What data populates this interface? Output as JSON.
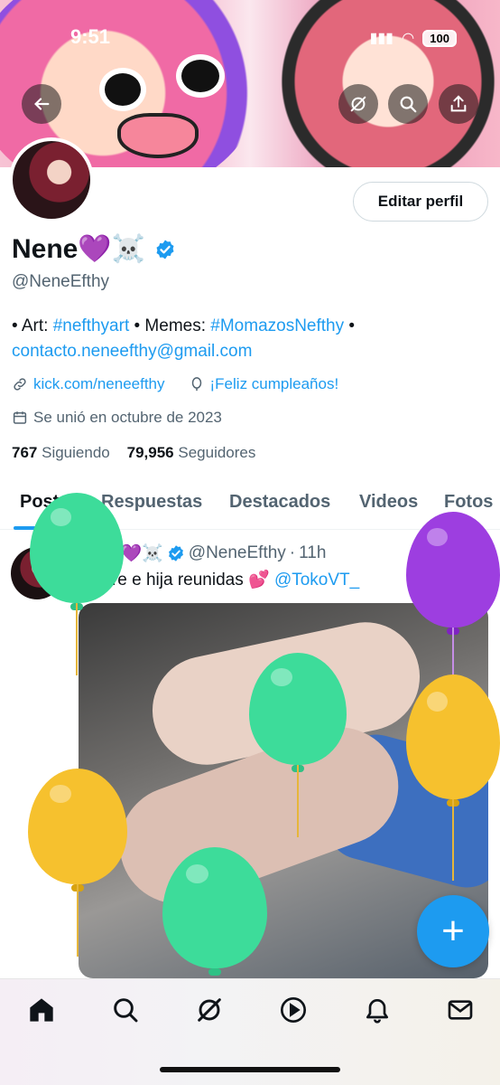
{
  "status_bar": {
    "time": "9:51",
    "battery": "100"
  },
  "profile": {
    "edit_button": "Editar perfil",
    "name": "Nene💜☠️",
    "handle": "@NeneEfthy",
    "bio": {
      "part1": "• Art: ",
      "tag1": "#nefthyart",
      "part2": " • Memes: ",
      "tag2": "#MomazosNefthy",
      "part3": " •",
      "email": "contacto.neneefthy@gmail.com"
    },
    "website": "kick.com/neneefthy",
    "birthday": "¡Feliz cumpleaños!",
    "joined": "Se unió en octubre de 2023",
    "following_count": "767",
    "following_label": "Siguiendo",
    "followers_count": "79,956",
    "followers_label": "Seguidores"
  },
  "tabs": [
    "Posts",
    "Respuestas",
    "Destacados",
    "Videos",
    "Fotos"
  ],
  "post": {
    "author": "Nene💜☠️",
    "handle": "@NeneEfthy",
    "time": "11h",
    "text": "Madre e hija reunidas 💕 ",
    "mention": "@TokoVT_",
    "more": "···"
  },
  "fab_symbol": "+",
  "bottom_nav": [
    "home-icon",
    "search-icon",
    "grok-icon",
    "video-icon",
    "notifications-icon",
    "messages-icon"
  ],
  "colors": {
    "accent": "#1d9bf0",
    "text": "#0f1419",
    "muted": "#536471"
  },
  "balloons": [
    {
      "color": "#3ddc9a",
      "knot": "#2fc185"
    },
    {
      "color": "#9d3ee0",
      "knot": "#7f22c2"
    },
    {
      "color": "#3ddc9a",
      "knot": "#2fc185"
    },
    {
      "color": "#f6c12e",
      "knot": "#d9a30e"
    },
    {
      "color": "#f6c12e",
      "knot": "#d9a30e"
    },
    {
      "color": "#3ddc9a",
      "knot": "#2fc185"
    }
  ]
}
